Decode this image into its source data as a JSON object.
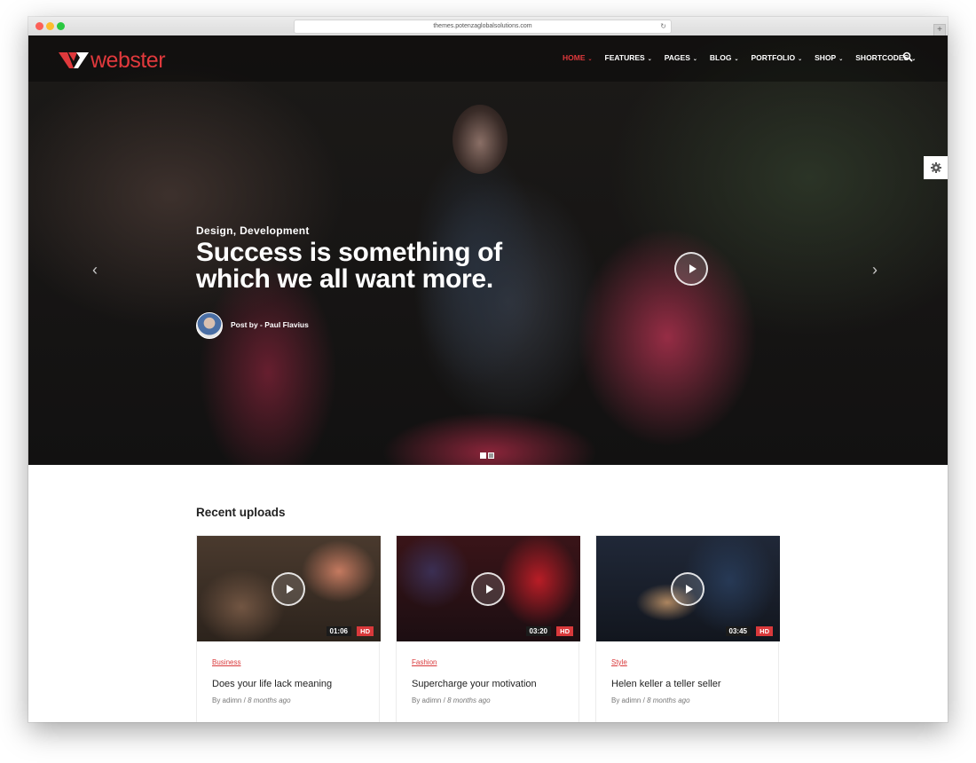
{
  "browser": {
    "url": "themes.potenzaglobalsolutions.com"
  },
  "header": {
    "logo_text": "webster",
    "nav": [
      {
        "label": "HOME",
        "active": true
      },
      {
        "label": "FEATURES",
        "active": false
      },
      {
        "label": "PAGES",
        "active": false
      },
      {
        "label": "BLOG",
        "active": false
      },
      {
        "label": "PORTFOLIO",
        "active": false
      },
      {
        "label": "SHOP",
        "active": false
      },
      {
        "label": "SHORTCODES",
        "active": false
      }
    ]
  },
  "hero": {
    "category": "Design, Development",
    "title_line1": "Success is something of",
    "title_line2": "which we all want more.",
    "author": "Post by - Paul Flavius",
    "slides_total": 2,
    "slide_active": 1
  },
  "recent": {
    "title": "Recent uploads",
    "cards": [
      {
        "category": "Business",
        "title": "Does your life lack meaning",
        "author": "By adimn",
        "separator": "/",
        "time": "8 months ago",
        "duration": "01:06",
        "quality": "HD"
      },
      {
        "category": "Fashion",
        "title": "Supercharge your motivation",
        "author": "By adimn",
        "separator": "/",
        "time": "8 months ago",
        "duration": "03:20",
        "quality": "HD"
      },
      {
        "category": "Style",
        "title": "Helen keller a teller seller",
        "author": "By adimn",
        "separator": "/",
        "time": "8 months ago",
        "duration": "03:45",
        "quality": "HD"
      }
    ]
  },
  "colors": {
    "accent": "#e0393c",
    "badge_dark": "#1b1b1b"
  }
}
